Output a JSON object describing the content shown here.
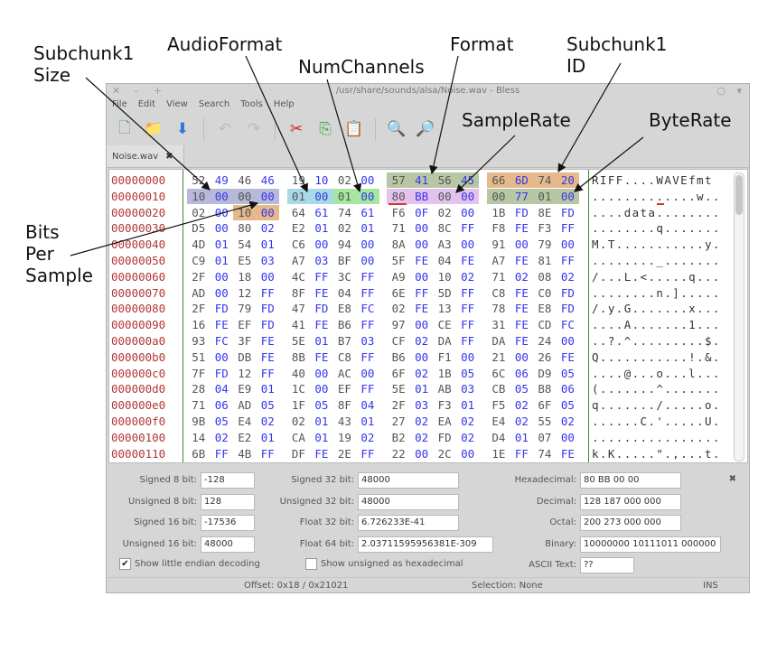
{
  "window": {
    "title": "/usr/share/sounds/alsa/Noise.wav - Bless",
    "controls": [
      "✕",
      "–",
      "+"
    ]
  },
  "menu": [
    "File",
    "Edit",
    "View",
    "Search",
    "Tools",
    "Help"
  ],
  "toolbar": [
    {
      "icon": "new-file-icon",
      "glyph": "🗋"
    },
    {
      "icon": "open-folder-icon",
      "glyph": "📁"
    },
    {
      "icon": "save-icon",
      "glyph": "⬇"
    },
    {
      "icon": "undo-icon",
      "glyph": "↶"
    },
    {
      "icon": "redo-icon",
      "glyph": "↷"
    },
    {
      "icon": "cut-icon",
      "glyph": "✂"
    },
    {
      "icon": "copy-icon",
      "glyph": "⎘"
    },
    {
      "icon": "paste-icon",
      "glyph": "📋"
    },
    {
      "icon": "find-icon",
      "glyph": "🔍"
    },
    {
      "icon": "find-replace-icon",
      "glyph": "🔎"
    }
  ],
  "tab": {
    "label": "Noise.wav",
    "close": "✖"
  },
  "rows": [
    {
      "offset": "00000000",
      "hex": "52 49 46 46 19 10 02 00 57 41 56 45 66 6D 74 20",
      "ascii": "RIFF....WAVEfmt "
    },
    {
      "offset": "00000010",
      "hex": "10 00 00 00 01 00 01 00 80 BB 00 00 00 77 01 00",
      "ascii": ".............w.."
    },
    {
      "offset": "00000020",
      "hex": "02 00 10 00 64 61 74 61 F6 0F 02 00 1B FD 8E FD",
      "ascii": "....data........"
    },
    {
      "offset": "00000030",
      "hex": "D5 00 80 02 E2 01 02 01 71 00 8C FF F8 FE F3 FF",
      "ascii": "........q......."
    },
    {
      "offset": "00000040",
      "hex": "4D 01 54 01 C6 00 94 00 8A 00 A3 00 91 00 79 00",
      "ascii": "M.T...........y."
    },
    {
      "offset": "00000050",
      "hex": "C9 01 E5 03 A7 03 BF 00 5F FE 04 FE A7 FE 81 FF",
      "ascii": "........_......."
    },
    {
      "offset": "00000060",
      "hex": "2F 00 18 00 4C FF 3C FF A9 00 10 02 71 02 08 02",
      "ascii": "/...L.<.....q..."
    },
    {
      "offset": "00000070",
      "hex": "AD 00 12 FF 8F FE 04 FF 6E FF 5D FF C8 FE C0 FD",
      "ascii": "........n.]....."
    },
    {
      "offset": "00000080",
      "hex": "2F FD 79 FD 47 FD E8 FC 02 FE 13 FF 78 FE E8 FD",
      "ascii": "/.y.G.......x..."
    },
    {
      "offset": "00000090",
      "hex": "16 FE EF FD 41 FE B6 FF 97 00 CE FF 31 FE CD FC",
      "ascii": "....A.......1..."
    },
    {
      "offset": "000000a0",
      "hex": "93 FC 3F FE 5E 01 B7 03 CF 02 DA FF DA FE 24 00",
      "ascii": "..?.^.........$."
    },
    {
      "offset": "000000b0",
      "hex": "51 00 DB FE 8B FE C8 FF B6 00 F1 00 21 00 26 FE",
      "ascii": "Q...........!.&."
    },
    {
      "offset": "000000c0",
      "hex": "7F FD 12 FF 40 00 AC 00 6F 02 1B 05 6C 06 D9 05",
      "ascii": "....@...o...l..."
    },
    {
      "offset": "000000d0",
      "hex": "28 04 E9 01 1C 00 EF FF 5E 01 AB 03 CB 05 B8 06",
      "ascii": "(.......^......."
    },
    {
      "offset": "000000e0",
      "hex": "71 06 AD 05 1F 05 8F 04 2F 03 F3 01 F5 02 6F 05",
      "ascii": "q......./.....o."
    },
    {
      "offset": "000000f0",
      "hex": "9B 05 E4 02 02 01 43 01 27 02 EA 02 E4 02 55 02",
      "ascii": "......C.'.....U."
    },
    {
      "offset": "00000100",
      "hex": "14 02 E2 01 CA 01 19 02 B2 02 FD 02 D4 01 07 00",
      "ascii": "................"
    },
    {
      "offset": "00000110",
      "hex": "6B FF 4B FF DF FE 2E FF 22 00 2C 00 1E FF 74 FE",
      "ascii": "k.K.....\".,...t."
    }
  ],
  "highlights": [
    {
      "row": 0,
      "from": 8,
      "to": 11,
      "color": "#b7c7a3"
    },
    {
      "row": 0,
      "from": 12,
      "to": 15,
      "color": "#e6b98c"
    },
    {
      "row": 1,
      "from": 0,
      "to": 3,
      "color": "#b6b9d9"
    },
    {
      "row": 1,
      "from": 4,
      "to": 5,
      "color": "#a9d9e6"
    },
    {
      "row": 1,
      "from": 6,
      "to": 7,
      "color": "#a6e6a0"
    },
    {
      "row": 1,
      "from": 8,
      "to": 11,
      "color": "#e4c2ee"
    },
    {
      "row": 1,
      "from": 12,
      "to": 15,
      "color": "#b7c7a3"
    },
    {
      "row": 2,
      "from": 2,
      "to": 3,
      "color": "#e6b98c"
    }
  ],
  "cursor": {
    "row": 1,
    "byte": 8,
    "color": "#e03030"
  },
  "colors": {
    "offset": "#b03838",
    "even_byte": "#555555",
    "odd_byte": "#3535ee",
    "divider": "#3a8a3a"
  },
  "panel": {
    "col1": [
      {
        "label": "Signed 8 bit:",
        "value": "-128"
      },
      {
        "label": "Unsigned 8 bit:",
        "value": "128"
      },
      {
        "label": "Signed 16 bit:",
        "value": "-17536"
      },
      {
        "label": "Unsigned 16 bit:",
        "value": "48000"
      }
    ],
    "col2": [
      {
        "label": "Signed 32 bit:",
        "value": "48000"
      },
      {
        "label": "Unsigned 32 bit:",
        "value": "48000"
      },
      {
        "label": "Float 32 bit:",
        "value": "6.726233E-41"
      },
      {
        "label": "Float 64 bit:",
        "value": "2.03711595956381E-309"
      }
    ],
    "col3": [
      {
        "label": "Hexadecimal:",
        "value": "80 BB 00 00"
      },
      {
        "label": "Decimal:",
        "value": "128 187 000 000"
      },
      {
        "label": "Octal:",
        "value": "200 273 000 000"
      },
      {
        "label": "Binary:",
        "value": "10000000 10111011 000000"
      },
      {
        "label": "ASCII Text:",
        "value": "??"
      }
    ],
    "little_endian": {
      "label": "Show little endian decoding",
      "checked": true
    },
    "unsigned_hex": {
      "label": "Show unsigned as hexadecimal",
      "checked": false
    },
    "close": "✖"
  },
  "status": {
    "offset": "Offset: 0x18 / 0x21021",
    "selection": "Selection: None",
    "mode": "INS"
  },
  "annotations": {
    "subchunk1_size": "Subchunk1\nSize",
    "audio_format": "AudioFormat",
    "num_channels": "NumChannels",
    "format": "Format",
    "subchunk1_id": "Subchunk1\nID",
    "sample_rate": "SampleRate",
    "byte_rate": "ByteRate",
    "bits_per_sample": "Bits\nPer\nSample"
  }
}
